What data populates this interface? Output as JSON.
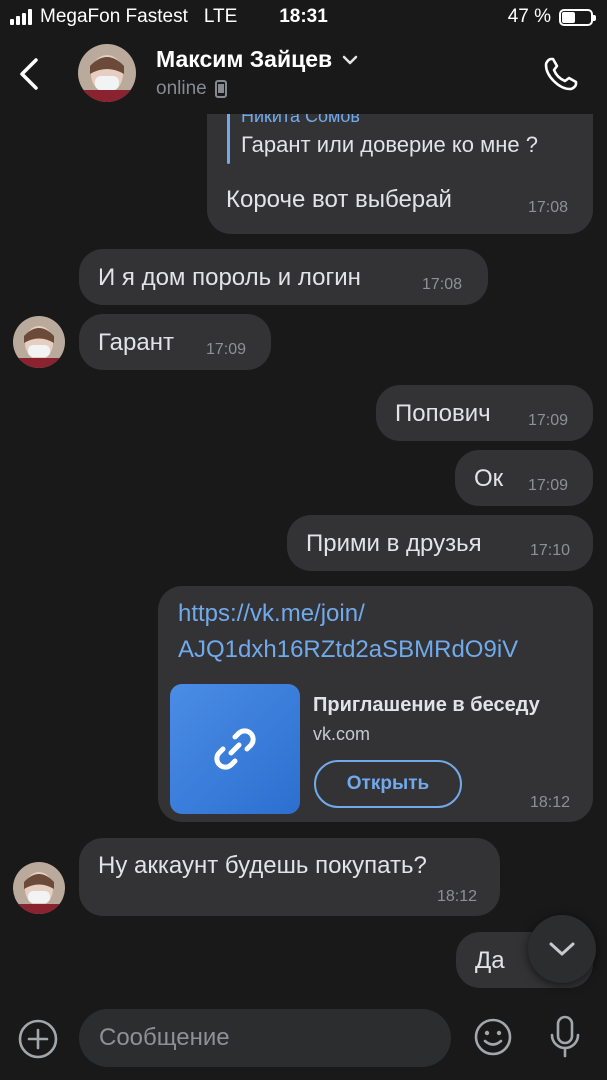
{
  "status_bar": {
    "carrier": "MegaFon Fastest",
    "network": "LTE",
    "time": "18:31",
    "battery": "47 %",
    "battery_level": 0.47
  },
  "header": {
    "name": "Максим Зайцев",
    "status": "online"
  },
  "messages": [
    {
      "id": "m1",
      "direction": "out",
      "reply_author": "Никита Сомов",
      "reply_text": "Гарант или доверие ко мне ?",
      "text": "Короче вот выберай",
      "time": "17:08"
    },
    {
      "id": "m2",
      "direction": "in",
      "text": "И я дом пороль и логин",
      "time": "17:08"
    },
    {
      "id": "m3",
      "direction": "in",
      "text": "Гарант",
      "time": "17:09"
    },
    {
      "id": "m4",
      "direction": "out",
      "text": "Попович",
      "time": "17:09"
    },
    {
      "id": "m5",
      "direction": "out",
      "text": "Ок",
      "time": "17:09"
    },
    {
      "id": "m6",
      "direction": "out",
      "text": "Прими в друзья",
      "time": "17:10"
    },
    {
      "id": "m7",
      "direction": "out",
      "link_line1": "https://vk.me/join/",
      "link_line2": "AJQ1dxh16RZtd2aSBMRdO9iV",
      "card_title": "Приглашение в беседу",
      "card_domain": "vk.com",
      "card_button": "Открыть",
      "time": "18:12"
    },
    {
      "id": "m8",
      "direction": "in",
      "text": "Ну аккаунт будешь покупать?",
      "time": "18:12"
    },
    {
      "id": "m9",
      "direction": "out",
      "text": "Да"
    }
  ],
  "composer": {
    "placeholder": "Сообщение"
  },
  "colors": {
    "background": "#19191a",
    "bubble": "#333335",
    "accent": "#71aaeb",
    "secondary_text": "#8d9096"
  }
}
